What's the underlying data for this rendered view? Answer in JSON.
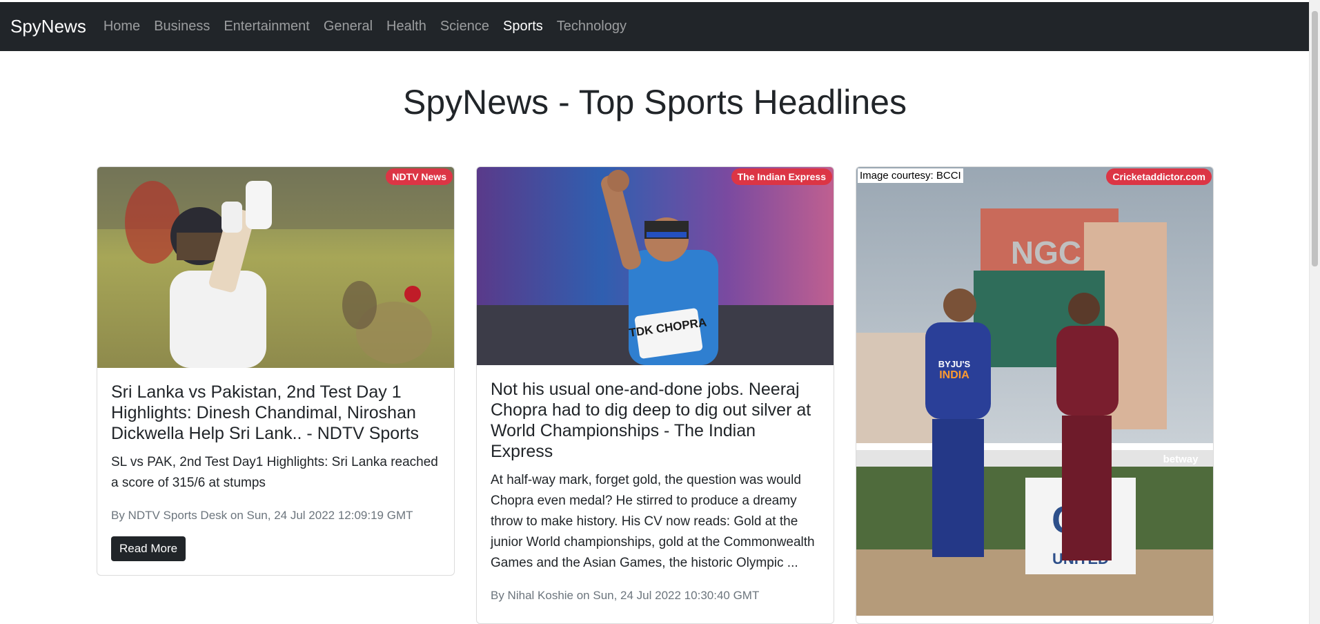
{
  "nav": {
    "brand": "SpyNews",
    "links": [
      "Home",
      "Business",
      "Entertainment",
      "General",
      "Health",
      "Science",
      "Sports",
      "Technology"
    ],
    "active": "Sports"
  },
  "page": {
    "title": "SpyNews - Top Sports Headlines"
  },
  "cards": [
    {
      "source": "NDTV News",
      "title": "Sri Lanka vs Pakistan, 2nd Test Day 1 Highlights: Dinesh Chandimal, Niroshan Dickwella Help Sri Lank.. - NDTV Sports",
      "description": "SL vs PAK, 2nd Test Day1 Highlights: Sri Lanka reached a score of 315/6 at stumps",
      "meta": "By NDTV Sports Desk on Sun, 24 Jul 2022 12:09:19 GMT",
      "button": "Read More"
    },
    {
      "source": "The Indian Express",
      "title": "Not his usual one-and-done jobs. Neeraj Chopra had to dig deep to dig out silver at World Championships - The Indian Express",
      "description": "At half-way mark, forget gold, the question was would Chopra even medal? He stirred to produce a dreamy throw to make history. His CV now reads: Gold at the junior World championships, gold at the Commonwealth Games and the Asian Games, the historic Olympic ...",
      "meta": "By Nihal Koshie on Sun, 24 Jul 2022 10:30:40 GMT",
      "jersey_text": "TDK CHOPRA"
    },
    {
      "source": "Cricketaddictor.com",
      "image_caption": "Image courtesy: BCCI",
      "signage": [
        "NGC",
        "CG",
        "UNITED",
        "INDIA",
        "BYJU'S",
        "betway"
      ]
    }
  ],
  "colors": {
    "navbar": "#212529",
    "badge": "#dc3545",
    "muted": "#6c757d"
  }
}
